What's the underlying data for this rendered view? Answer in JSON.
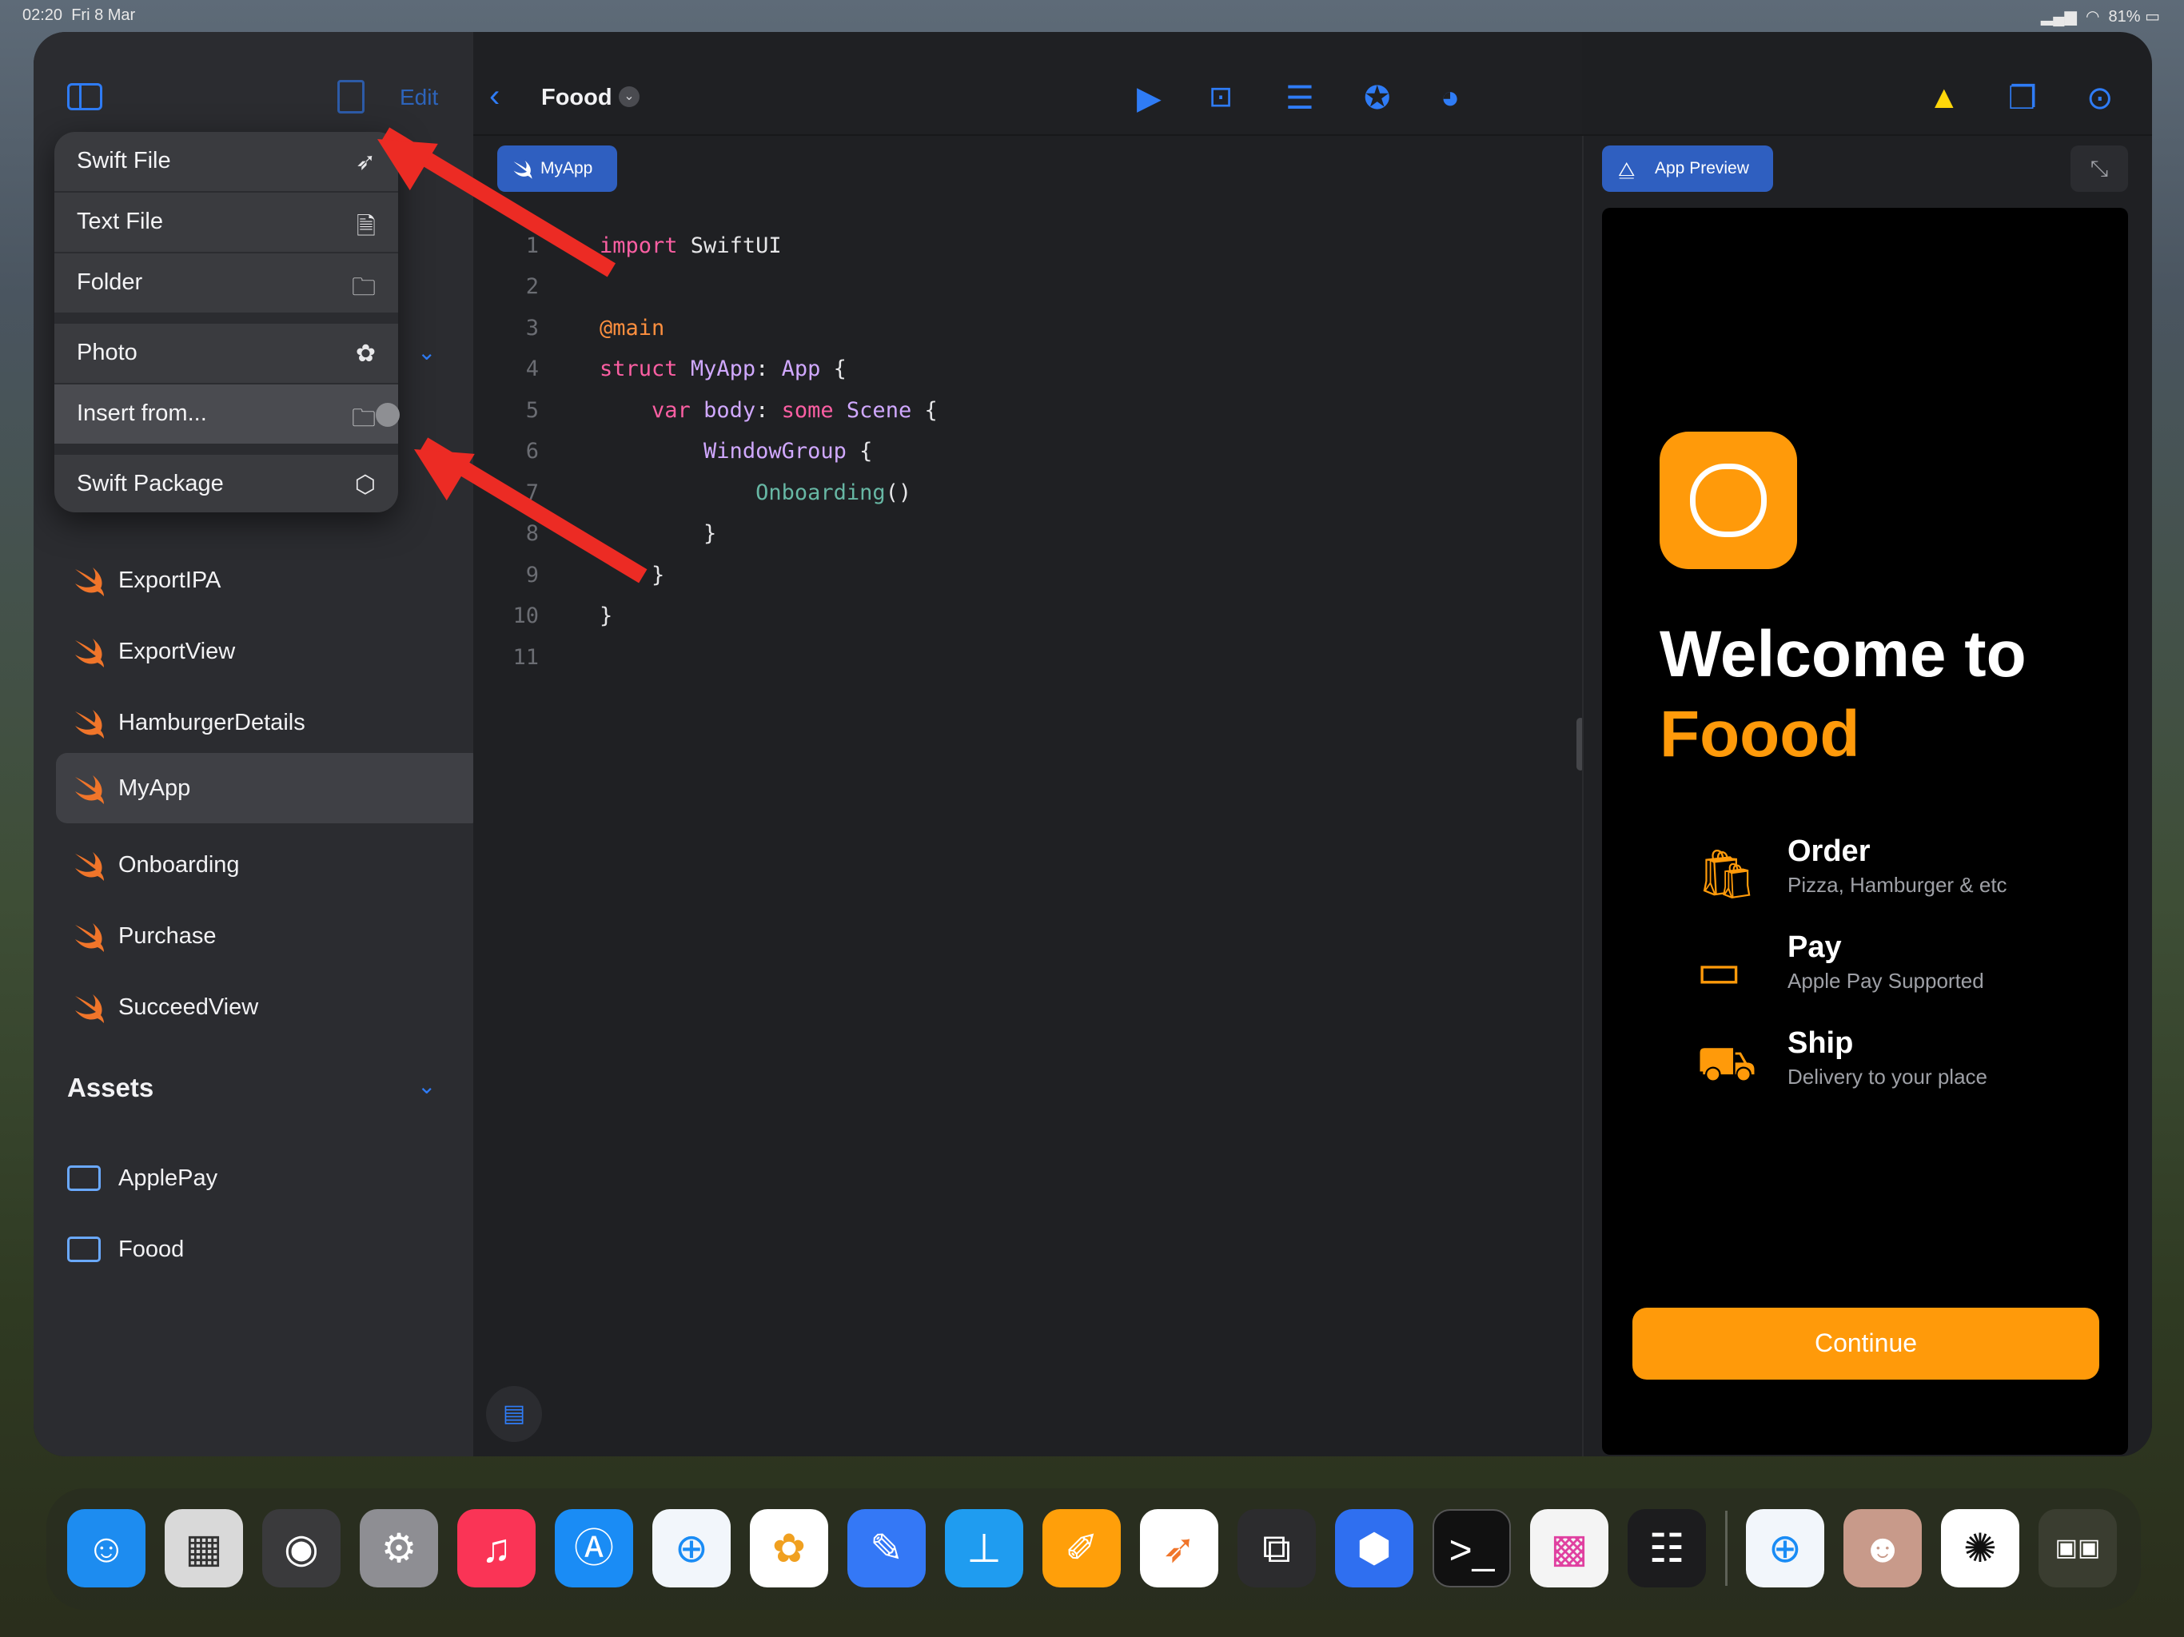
{
  "status_bar": {
    "time": "02:20",
    "date": "Fri 8 Mar",
    "battery": "81%"
  },
  "sidebar": {
    "edit_label": "Edit",
    "files": [
      "ExportIPA",
      "ExportView",
      "HamburgerDetails",
      "MyApp",
      "Onboarding",
      "Purchase",
      "SucceedView"
    ],
    "selected_file": "MyApp",
    "assets_header": "Assets",
    "assets": [
      "ApplePay",
      "Foood"
    ]
  },
  "new_file_menu": {
    "items": [
      {
        "label": "Swift File",
        "icon": "swift-icon"
      },
      {
        "label": "Text File",
        "icon": "document-icon"
      },
      {
        "label": "Folder",
        "icon": "folder-badge-plus-icon"
      },
      {
        "label": "Photo",
        "icon": "flower-icon"
      },
      {
        "label": "Insert from...",
        "icon": "folder-icon"
      },
      {
        "label": "Swift Package",
        "icon": "package-icon"
      }
    ],
    "highlighted": "Insert from..."
  },
  "toolbar": {
    "project_title": "Foood",
    "icons": [
      "play-icon",
      "stop-icon",
      "sliders-icon",
      "star-circle-icon",
      "palette-icon",
      "warning-icon",
      "square-stack-icon",
      "more-icon"
    ]
  },
  "editor": {
    "tab_label": "MyApp",
    "line_numbers": [
      "1",
      "2",
      "3",
      "4",
      "5",
      "6",
      "7",
      "8",
      "9",
      "10",
      "11"
    ]
  },
  "preview": {
    "pill_label": "App Preview",
    "welcome_line1": "Welcome to",
    "welcome_line2": "Foood",
    "features": [
      {
        "title": "Order",
        "subtitle": "Pizza, Hamburger & etc"
      },
      {
        "title": "Pay",
        "subtitle": "Apple Pay Supported"
      },
      {
        "title": "Ship",
        "subtitle": "Delivery to your place"
      }
    ],
    "continue_label": "Continue",
    "accent": "#ff9a0a"
  },
  "dock": {
    "apps": [
      "finder-icon",
      "calculator-icon",
      "instruments-icon",
      "settings-icon",
      "music-icon",
      "app-store-icon",
      "safari-icon",
      "photos-icon",
      "pencil-app-icon",
      "keynote-icon",
      "pages-icon",
      "swift-playgrounds-icon",
      "stage-manager-icon",
      "box-app-icon",
      "terminal-icon",
      "color-app-icon",
      "screen-app-icon",
      "safari-icon",
      "avatar-app-icon",
      "chatgpt-icon",
      "app-folder-icon"
    ]
  },
  "colors": {
    "accent_blue": "#2f7cf6",
    "annotation_red": "#ec2b24"
  }
}
